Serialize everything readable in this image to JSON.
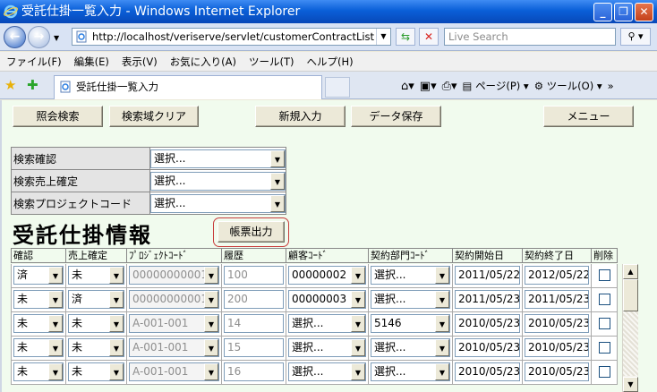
{
  "window": {
    "title": "受託仕掛一覧入力 - Windows Internet Explorer"
  },
  "address": {
    "url": "http://localhost/veriserve/servlet/customerContractList",
    "search_placeholder": "Live Search"
  },
  "menu": [
    "ファイル(F)",
    "編集(E)",
    "表示(V)",
    "お気に入り(A)",
    "ツール(T)",
    "ヘルプ(H)"
  ],
  "tab": {
    "label": "受託仕掛一覧入力"
  },
  "commands": {
    "page": "ページ(P)",
    "tools": "ツール(O)"
  },
  "toolbar": {
    "search": "照会検索",
    "clear": "検索域クリア",
    "new": "新規入力",
    "save": "データ保存",
    "menu": "メニュー"
  },
  "filters": [
    {
      "label": "検索確認",
      "value": "選択..."
    },
    {
      "label": "検索売上確定",
      "value": "選択..."
    },
    {
      "label": "検索プロジェクトコード",
      "value": "選択..."
    }
  ],
  "section": {
    "title": "受託仕掛情報",
    "report_button": "帳票出力"
  },
  "grid": {
    "columns": [
      "確認",
      "売上確定",
      "ﾌﾟﾛｼﾞｪｸﾄｺｰﾄﾞ",
      "履歴",
      "顧客ｺｰﾄﾞ",
      "契約部門ｺｰﾄﾞ",
      "契約開始日",
      "契約終了日",
      "削除"
    ],
    "rows": [
      {
        "confirm": "済",
        "sales": "未",
        "project": "00000000001",
        "history": "100",
        "customer": "00000002",
        "dept": "選択...",
        "start": "2011/05/22",
        "end": "2012/05/22"
      },
      {
        "confirm": "未",
        "sales": "済",
        "project": "00000000001",
        "history": "200",
        "customer": "00000003",
        "dept": "選択...",
        "start": "2011/05/23",
        "end": "2011/05/23"
      },
      {
        "confirm": "未",
        "sales": "未",
        "project": "A-001-001",
        "history": "14",
        "customer": "選択...",
        "dept": "5146",
        "start": "2010/05/23",
        "end": "2010/05/23"
      },
      {
        "confirm": "未",
        "sales": "未",
        "project": "A-001-001",
        "history": "15",
        "customer": "選択...",
        "dept": "選択...",
        "start": "2010/05/23",
        "end": "2010/05/23"
      },
      {
        "confirm": "未",
        "sales": "未",
        "project": "A-001-001",
        "history": "16",
        "customer": "選択...",
        "dept": "選択...",
        "start": "2010/05/23",
        "end": "2010/05/23"
      }
    ]
  }
}
